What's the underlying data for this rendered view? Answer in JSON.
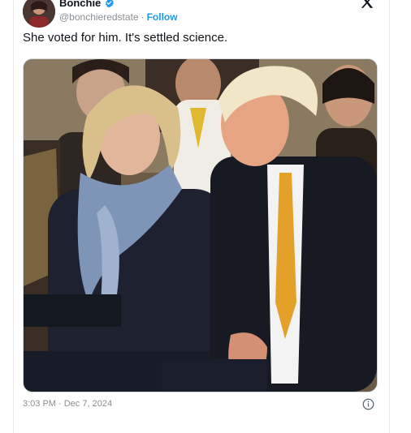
{
  "author": {
    "display_name": "Bonchie",
    "handle": "@bonchieredstate",
    "separator": "·",
    "follow_label": "Follow",
    "verified_icon": "verified-badge-icon"
  },
  "tweet": {
    "text": "She voted for him. It's settled science.",
    "timestamp": "3:03 PM · Dec 7, 2024"
  },
  "media": {
    "description_icon": "photo"
  },
  "colors": {
    "accent": "#1d9bf0",
    "secondary_text": "#8a8f94",
    "primary_text": "#0f1419"
  }
}
